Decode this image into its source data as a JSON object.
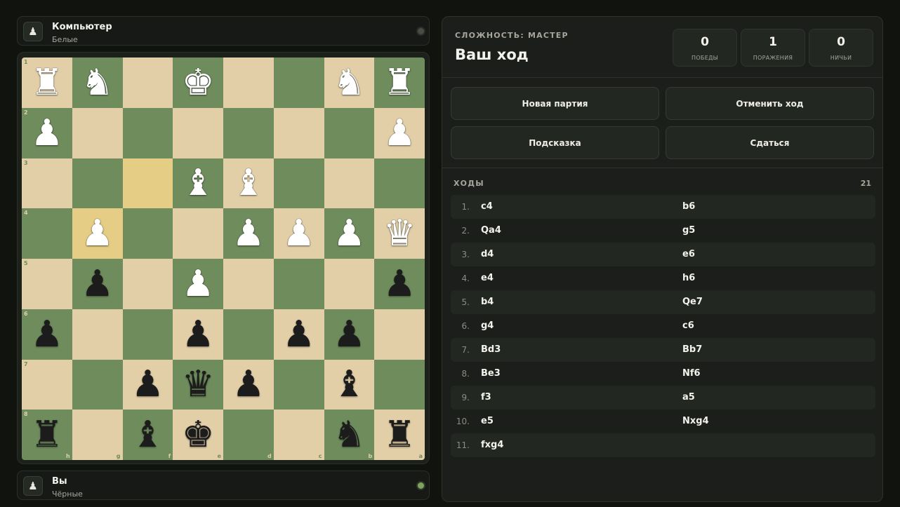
{
  "top_player": {
    "name": "Компьютер",
    "color": "Белые",
    "icon": "pawn-icon"
  },
  "bottom_player": {
    "name": "Вы",
    "color": "Чёрные",
    "icon": "pawn-icon"
  },
  "board": {
    "rank_labels": [
      "1",
      "2",
      "3",
      "4",
      "5",
      "6",
      "7",
      "8"
    ],
    "file_labels": [
      "h",
      "g",
      "f",
      "e",
      "d",
      "c",
      "b",
      "a"
    ],
    "highlighted": [
      [
        2,
        2
      ],
      [
        3,
        1
      ]
    ],
    "rows": [
      [
        "wR",
        "wN",
        "",
        "wK",
        "",
        "",
        "wN",
        "wR"
      ],
      [
        "wP",
        "",
        "",
        "",
        "",
        "",
        "",
        "wP"
      ],
      [
        "",
        "",
        "",
        "wB",
        "wB",
        "",
        "",
        ""
      ],
      [
        "",
        "wP",
        "",
        "",
        "wP",
        "wP",
        "wP",
        "wQ"
      ],
      [
        "",
        "bP",
        "",
        "wP",
        "",
        "",
        "",
        "bP"
      ],
      [
        "bP",
        "",
        "",
        "bP",
        "",
        "bP",
        "bP",
        ""
      ],
      [
        "",
        "",
        "bP",
        "bQ",
        "bP",
        "",
        "bB",
        ""
      ],
      [
        "bR",
        "",
        "bB",
        "bK",
        "",
        "",
        "bN",
        "bR"
      ]
    ]
  },
  "panel": {
    "difficulty": "СЛОЖНОСТЬ: МАСТЕР",
    "turn": "Ваш ход",
    "stats": [
      {
        "value": "0",
        "label": "ПОБЕДЫ"
      },
      {
        "value": "1",
        "label": "ПОРАЖЕНИЯ"
      },
      {
        "value": "0",
        "label": "НИЧЬИ"
      }
    ],
    "buttons": {
      "new_game": "Новая партия",
      "undo": "Отменить ход",
      "hint": "Подсказка",
      "resign": "Сдаться"
    },
    "moves_title": "ХОДЫ",
    "moves_count": "21",
    "moves": [
      {
        "num": "1.",
        "white": "c4",
        "black": "b6"
      },
      {
        "num": "2.",
        "white": "Qa4",
        "black": "g5"
      },
      {
        "num": "3.",
        "white": "d4",
        "black": "e6"
      },
      {
        "num": "4.",
        "white": "e4",
        "black": "h6"
      },
      {
        "num": "5.",
        "white": "b4",
        "black": "Qe7"
      },
      {
        "num": "6.",
        "white": "g4",
        "black": "c6"
      },
      {
        "num": "7.",
        "white": "Bd3",
        "black": "Bb7"
      },
      {
        "num": "8.",
        "white": "Be3",
        "black": "Nf6"
      },
      {
        "num": "9.",
        "white": "f3",
        "black": "a5"
      },
      {
        "num": "10.",
        "white": "e5",
        "black": "Nxg4"
      },
      {
        "num": "11.",
        "white": "fxg4",
        "black": ""
      }
    ]
  },
  "colors": {
    "light_square": "#e2cfa8",
    "dark_square": "#6e8c5c",
    "highlight_square": "#e6cd85",
    "active_dot": "#7fa35e"
  }
}
